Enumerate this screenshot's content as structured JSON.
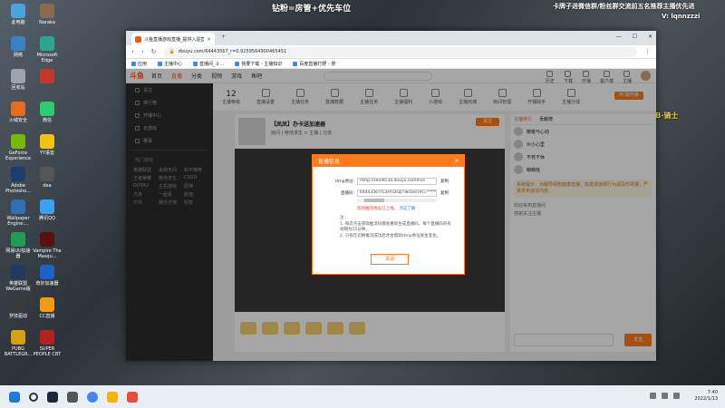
{
  "overlays": {
    "top": "钻粉=房管+优先车位",
    "right": "卡牌子进微信群/粉丝群交流前五名推荐主播优先进",
    "right2": "V: lqnnzzzi",
    "gold": "直播间礼品 · DB·骑士"
  },
  "desktop_icons": [
    {
      "label": "此电脑",
      "color": "#4aa3df"
    },
    {
      "label": "Naraka",
      "color": "#8a6b4b"
    },
    {
      "label": "网络",
      "color": "#3b82c4"
    },
    {
      "label": "Microsoft Edge",
      "color": "#2aa58f"
    },
    {
      "label": "回收站",
      "color": "#9aa4ad"
    },
    {
      "label": "",
      "color": "#c0392b"
    },
    {
      "label": "火绒安全",
      "color": "#e66b1f"
    },
    {
      "label": "微信",
      "color": "#2ecc71"
    },
    {
      "label": "GeForce Experience",
      "color": "#76b900"
    },
    {
      "label": "YY语音",
      "color": "#f1c40f"
    },
    {
      "label": "Adobe Photosho...",
      "color": "#1c3c6e"
    },
    {
      "label": "dea",
      "color": "#555"
    },
    {
      "label": "Wallpaper Engine:...",
      "color": "#2e6fb5"
    },
    {
      "label": "腾讯QQ",
      "color": "#3aa1f5"
    },
    {
      "label": "网易UU加速器",
      "color": "#1f9d55"
    },
    {
      "label": "Vampire The Masqu...",
      "color": "#5a1010"
    },
    {
      "label": "英雄联盟 WeGame版",
      "color": "#1e3a5f"
    },
    {
      "label": "奇妙加速器",
      "color": "#1b62c8"
    },
    {
      "label": "罗技驱动",
      "color": "#3a3a3a"
    },
    {
      "label": "CC直播",
      "color": "#f39c12"
    },
    {
      "label": "PUBG BATTLEGR...",
      "color": "#d4a017"
    },
    {
      "label": "SUPER PEOPLE CBT",
      "color": "#b22222"
    }
  ],
  "browser": {
    "tab_title": "斗鱼直播游戏直播_提供入驻直播",
    "new_tab": "+",
    "url": "douyu.com/644435​67_r=0.92595649004654​51",
    "bookmarks": [
      "应用",
      "主播中心",
      "直播间_斗...",
      "我要下载 - 主播知识",
      "百度直播打野 - 搜"
    ],
    "nav": [
      "‹",
      "›",
      "↻"
    ]
  },
  "douyu": {
    "logo": "斗鱼",
    "nav": [
      "首页",
      "直播",
      "分类",
      "视频",
      "游戏",
      "鱼吧"
    ],
    "active_nav": "直播",
    "right_menu": [
      "历史",
      "下载",
      "开播",
      "客户端",
      "主播"
    ],
    "left_nav": [
      "关注",
      "排行榜",
      "开播中心",
      "云游戏",
      "赛事"
    ],
    "left_section_title": "热门游戏",
    "left_grid": [
      "英雄联盟",
      "永劫无间",
      "和平精英",
      "王者荣耀",
      "绝地求生",
      "CSGO",
      "DOTA2",
      "主机游戏",
      "原神",
      "方舟",
      "一起看",
      "颜值",
      "户外",
      "娱乐天地",
      "科技"
    ],
    "categories": [
      {
        "label": "主播等级",
        "num": "12"
      },
      {
        "label": "直播设置",
        "num": ""
      },
      {
        "label": "主播任务",
        "num": ""
      },
      {
        "label": "直播数据",
        "num": ""
      },
      {
        "label": "主播任务",
        "num": ""
      },
      {
        "label": "主播福利",
        "num": ""
      },
      {
        "label": "小游戏",
        "num": ""
      },
      {
        "label": "主播商城",
        "num": ""
      },
      {
        "label": "房间管理",
        "num": ""
      },
      {
        "label": "开播助手",
        "num": ""
      },
      {
        "label": "主播分成",
        "num": ""
      }
    ],
    "pc_button": "PC端开播",
    "stream_title": "【凤凤】办卡送加速器",
    "stream_sub": "房间  | 绝地求生 > 主播  | 分享",
    "follow": "关注",
    "chat_tabs": [
      "主播排行",
      "贡献榜"
    ],
    "ranking": [
      "暖暖与心动",
      "Xi小心里",
      "不死不休",
      "萌萌哒"
    ],
    "notice": "系统提示：为倡导绿色健康直播，如发现违规行为请及时举报，严禁发布违法内容。",
    "chat_msgs": [
      "欢迎来到直播间",
      "感谢关注主播"
    ],
    "send": "发送"
  },
  "modal": {
    "title": "直播信息",
    "close_x": "×",
    "rtmp_label": "rtmp地址:",
    "rtmp_value": "rtmp://sendtc3a.douyu.com/live",
    "code_label": "直播码:",
    "code_value": "644435​67rCaHTDsqr?wsSecret=*********",
    "copy": "复制",
    "warn": "您的推流地址已上线。",
    "warn_link": "点这了解",
    "notes_title": "注:",
    "notes": [
      "1. 每次点击获取推流码都会重新生成直播码，每个直播码的有效期为15分钟。",
      "2. 只有在切换推流成功后才会帮助rtmp地址发生变化。"
    ],
    "close_button": "关闭"
  },
  "taskbar": {
    "time": "7:40",
    "date": "2022/1/13"
  }
}
